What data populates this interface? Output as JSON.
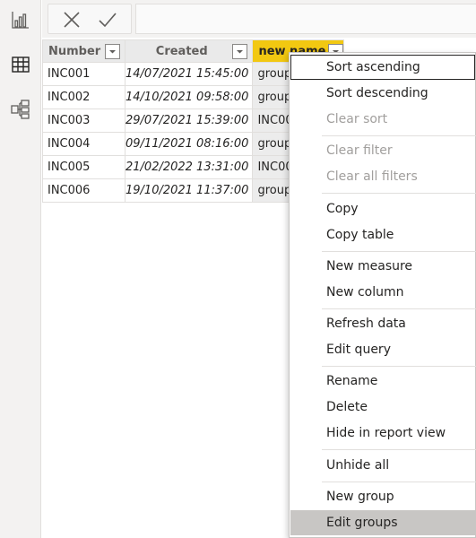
{
  "rail": {
    "items": [
      {
        "name": "report-view-icon"
      },
      {
        "name": "data-view-icon"
      },
      {
        "name": "model-view-icon"
      }
    ]
  },
  "formula_bar": {
    "cancel_icon": "close-icon",
    "commit_icon": "checkmark-icon",
    "value": ""
  },
  "table": {
    "columns": [
      "Number",
      "Created",
      "new name"
    ],
    "rows": [
      {
        "number": "INC001",
        "created": "14/07/2021 15:45:00",
        "new_name": "group"
      },
      {
        "number": "INC002",
        "created": "14/10/2021 09:58:00",
        "new_name": "group"
      },
      {
        "number": "INC003",
        "created": "29/07/2021 15:39:00",
        "new_name": "INC00"
      },
      {
        "number": "INC004",
        "created": "09/11/2021 08:16:00",
        "new_name": "group"
      },
      {
        "number": "INC005",
        "created": "21/02/2022 13:31:00",
        "new_name": "INC00"
      },
      {
        "number": "INC006",
        "created": "19/10/2021 11:37:00",
        "new_name": "group"
      }
    ],
    "selected_header_color": "#f2c811"
  },
  "context_menu": {
    "items": [
      {
        "label": "Sort ascending",
        "enabled": true
      },
      {
        "label": "Sort descending",
        "enabled": true
      },
      {
        "label": "Clear sort",
        "enabled": false
      },
      {
        "label": "Clear filter",
        "enabled": false
      },
      {
        "label": "Clear all filters",
        "enabled": false
      },
      {
        "label": "Copy",
        "enabled": true
      },
      {
        "label": "Copy table",
        "enabled": true
      },
      {
        "label": "New measure",
        "enabled": true
      },
      {
        "label": "New column",
        "enabled": true
      },
      {
        "label": "Refresh data",
        "enabled": true
      },
      {
        "label": "Edit query",
        "enabled": true
      },
      {
        "label": "Rename",
        "enabled": true
      },
      {
        "label": "Delete",
        "enabled": true
      },
      {
        "label": "Hide in report view",
        "enabled": true
      },
      {
        "label": "Unhide all",
        "enabled": true
      },
      {
        "label": "New group",
        "enabled": true
      },
      {
        "label": "Edit groups",
        "enabled": true
      }
    ],
    "focused_item": "Sort ascending",
    "hovered_item": "Edit groups"
  }
}
